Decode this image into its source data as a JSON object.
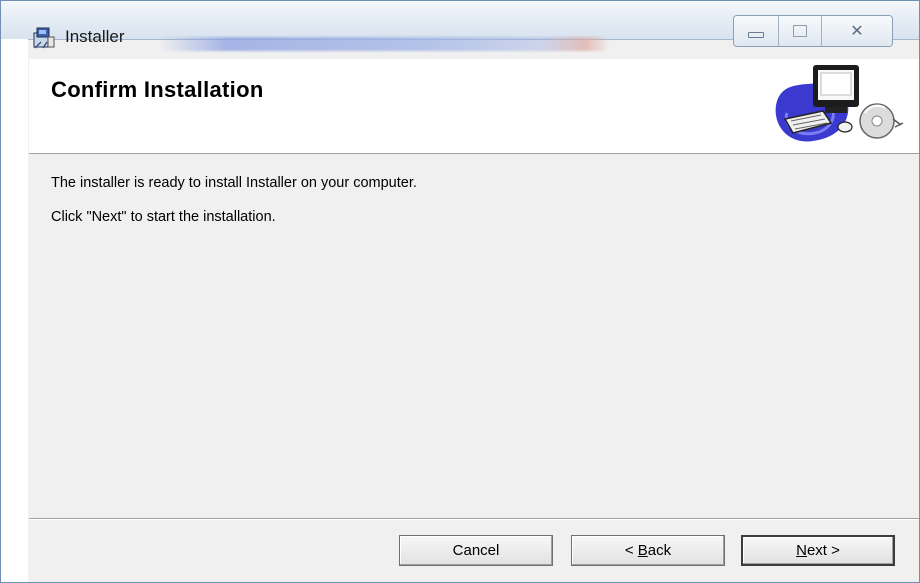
{
  "window": {
    "title": "Installer",
    "controls": {
      "minimize": "minimize",
      "maximize": "maximize",
      "close": "✕"
    }
  },
  "header": {
    "title": "Confirm Installation",
    "art_icon": "computer-cd-icon"
  },
  "content": {
    "line1": "The installer is ready to install Installer on your computer.",
    "line2": "Click \"Next\" to start the installation."
  },
  "buttons": {
    "cancel": "Cancel",
    "back_prefix": "< ",
    "back_accel": "B",
    "back_rest": "ack",
    "next_accel": "N",
    "next_rest": "ext >"
  },
  "colors": {
    "window_bg": "#f0f0f0",
    "header_bg": "#ffffff",
    "frame_border": "#6f8fb4"
  }
}
